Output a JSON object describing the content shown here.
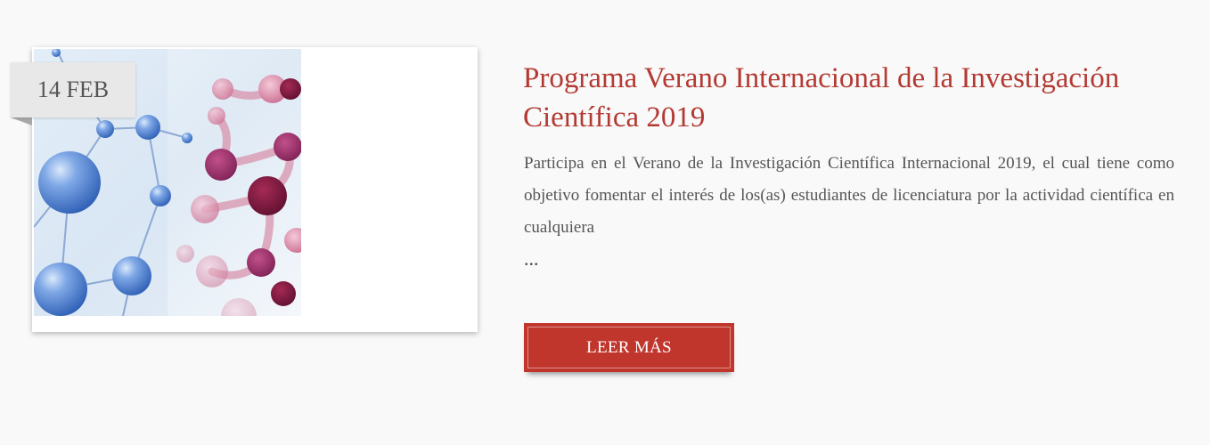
{
  "post": {
    "date": "14 FEB",
    "title": "Programa Verano Internacional de la Investigación Científica 2019",
    "excerpt": "Participa en el Verano de la Investigación Científica Internacional 2019, el cual tiene como objetivo fomentar el interés de los(as) estudiantes de licenciatura por la actividad científica en cualquiera",
    "ellipsis": "...",
    "read_more_label": "LEER MÁS"
  },
  "colors": {
    "accent": "#b33a33",
    "button": "#c0362c",
    "badge": "#e8e8e8",
    "text": "#555555"
  },
  "image": {
    "subject": "molecule-illustration"
  }
}
